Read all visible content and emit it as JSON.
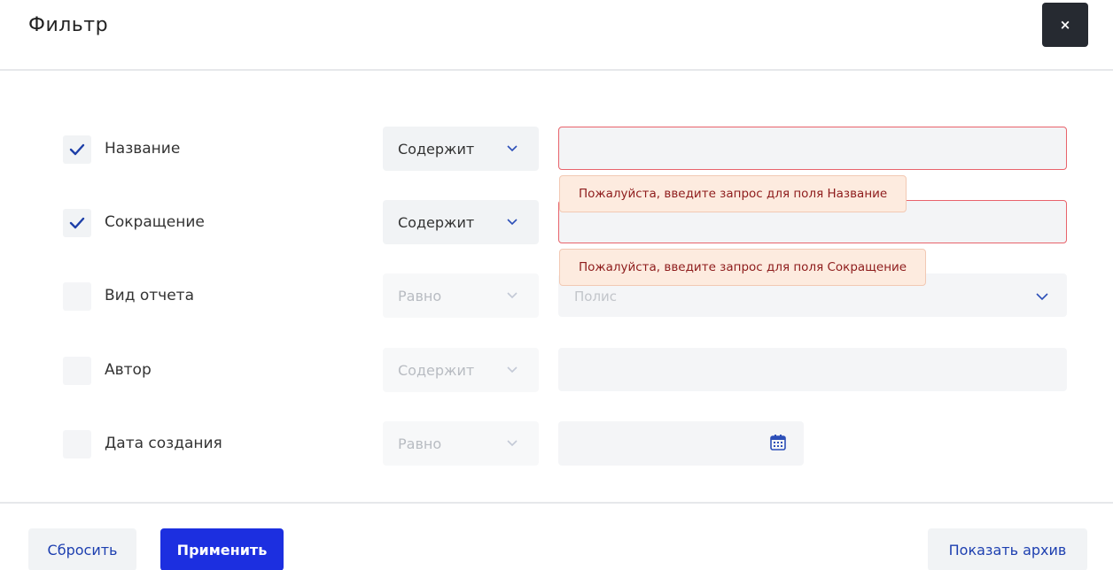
{
  "dialog": {
    "title": "Фильтр",
    "close_label": "×"
  },
  "filters": [
    {
      "checked": true,
      "label": "Название",
      "operator": "Содержит",
      "value": "",
      "error": true,
      "type": "text"
    },
    {
      "checked": true,
      "label": "Сокращение",
      "operator": "Содержит",
      "value": "",
      "error": true,
      "type": "text"
    },
    {
      "checked": false,
      "label": "Вид отчета",
      "operator": "Равно",
      "placeholder": "Полис",
      "type": "select"
    },
    {
      "checked": false,
      "label": "Автор",
      "operator": "Содержит",
      "value": "",
      "type": "text"
    },
    {
      "checked": false,
      "label": "Дата создания",
      "operator": "Равно",
      "value": "",
      "type": "date"
    }
  ],
  "validation": {
    "name_error": "Пожалуйста, введите запрос для поля Название",
    "short_error": "Пожалуйста, введите запрос для поля Сокращение"
  },
  "footer": {
    "reset_label": "Сбросить",
    "apply_label": "Применить",
    "archive_label": "Показать архив"
  },
  "colors": {
    "accent": "#1c2fe0",
    "check": "#1d3fa8",
    "error_border": "#e8636b",
    "error_bg": "#fdebdf",
    "error_text": "#8e1c1c"
  }
}
